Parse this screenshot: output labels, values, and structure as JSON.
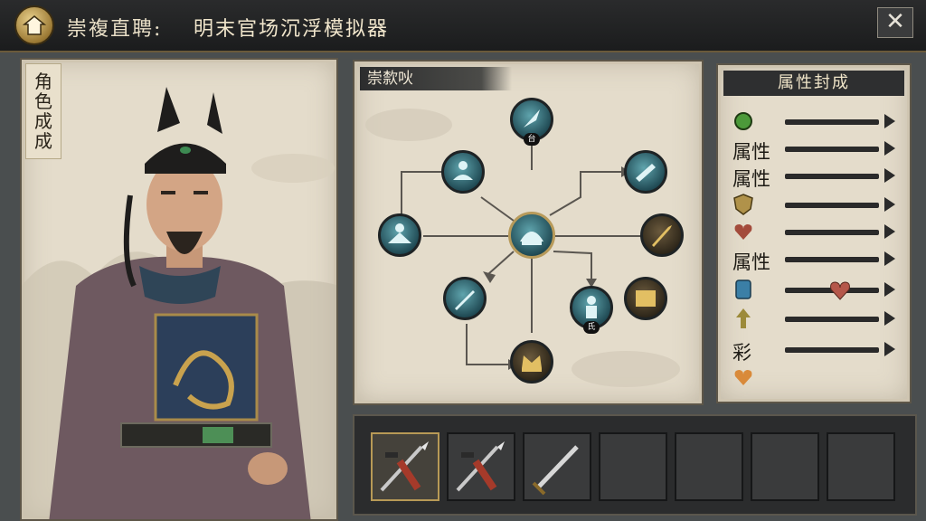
{
  "header": {
    "title_prefix": "崇複直聘:",
    "title_main": "明末官场沉浮模拟器",
    "home_icon": "home-roof-icon",
    "close_label": "✕"
  },
  "character_panel": {
    "vertical_label": [
      "角",
      "色",
      "成",
      "成"
    ]
  },
  "skill_tree": {
    "title": "崇歀吙",
    "center_label": "",
    "node_top_badge": "台",
    "node_lower_badge": "氏"
  },
  "attributes": {
    "header": "属性封成",
    "rows": [
      {
        "label": "",
        "icon": "green-gem-icon",
        "icon_color": "#4c9a3a"
      },
      {
        "label": "属性",
        "icon": "",
        "icon_color": ""
      },
      {
        "label": "属性",
        "icon": "",
        "icon_color": ""
      },
      {
        "label": "",
        "icon": "gold-shield-icon",
        "icon_color": "#b0924a"
      },
      {
        "label": "",
        "icon": "heart-icon",
        "icon_color": "#a34b3b"
      },
      {
        "label": "属性",
        "icon": "",
        "icon_color": ""
      },
      {
        "label": "",
        "icon": "scroll-badge-icon",
        "icon_color": "#3b7fa6"
      },
      {
        "label": "",
        "icon": "up-arrow-icon",
        "icon_color": "#9c8a3a"
      },
      {
        "label": "彩",
        "icon": "",
        "icon_color": ""
      },
      {
        "label": "",
        "icon": "orange-heart-icon",
        "icon_color": "#d98a3a"
      }
    ]
  },
  "equipment": {
    "slots": [
      {
        "item": "crossed-spear-icon",
        "selected": true
      },
      {
        "item": "crossed-spear-icon",
        "selected": false
      },
      {
        "item": "sword-icon",
        "selected": false
      },
      {
        "item": "",
        "selected": false
      },
      {
        "item": "",
        "selected": false
      },
      {
        "item": "",
        "selected": false
      },
      {
        "item": "",
        "selected": false
      }
    ]
  },
  "colors": {
    "panel_bg": "#e4dccb",
    "teal_node": "#3f7d86",
    "gold_accent": "#b79a5a",
    "title_bar": "#1f2021"
  }
}
